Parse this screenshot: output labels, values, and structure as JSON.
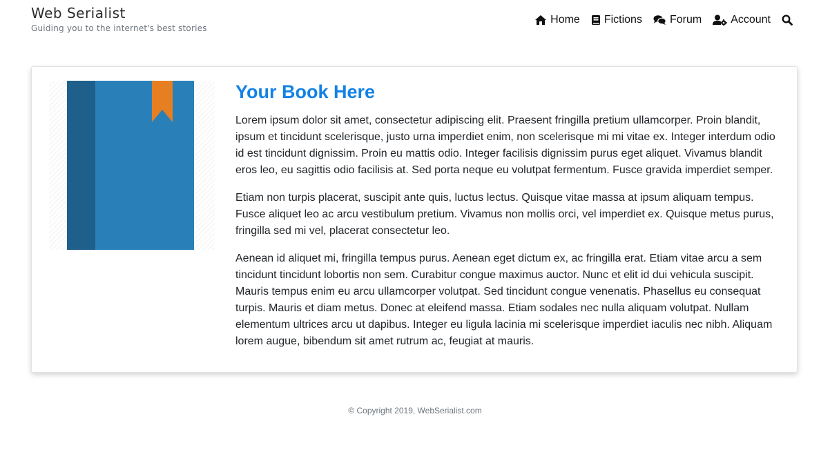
{
  "site": {
    "title": "Web Serialist",
    "tagline": "Guiding you to the internet's best stories"
  },
  "nav": {
    "items": [
      {
        "label": "Home",
        "icon": "home-icon"
      },
      {
        "label": "Fictions",
        "icon": "book-icon"
      },
      {
        "label": "Forum",
        "icon": "comments-icon"
      },
      {
        "label": "Account",
        "icon": "user-cog-icon"
      }
    ],
    "search_icon": "search-icon"
  },
  "book": {
    "title": "Your Book Here",
    "cover_colors": {
      "spine": "#1f5f8b",
      "cover": "#2980b9",
      "bookmark": "#e67e22"
    },
    "paragraphs": [
      "Lorem ipsum dolor sit amet, consectetur adipiscing elit. Praesent fringilla pretium ullamcorper. Proin blandit, ipsum et tincidunt scelerisque, justo urna imperdiet enim, non scelerisque mi mi vitae ex. Integer interdum odio id est tincidunt dignissim. Proin eu mattis odio. Integer facilisis dignissim purus eget aliquet. Vivamus blandit eros leo, eu sagittis odio facilisis at. Sed porta neque eu volutpat fermentum. Fusce gravida imperdiet semper.",
      "Etiam non turpis placerat, suscipit ante quis, luctus lectus. Quisque vitae massa at ipsum aliquam tempus. Fusce aliquet leo ac arcu vestibulum pretium. Vivamus non mollis orci, vel imperdiet ex. Quisque metus purus, fringilla sed mi vel, placerat consectetur leo.",
      "Aenean id aliquet mi, fringilla tempus purus. Aenean eget dictum ex, ac fringilla erat. Etiam vitae arcu a sem tincidunt tincidunt lobortis non sem. Curabitur congue maximus auctor. Nunc et elit id dui vehicula suscipit. Mauris tempus enim eu arcu ullamcorper volutpat. Sed tincidunt congue venenatis. Phasellus eu consequat turpis. Mauris et diam metus. Donec at eleifend massa. Etiam sodales nec nulla aliquam volutpat. Nullam elementum ultrices arcu ut dapibus. Integer eu ligula lacinia mi scelerisque imperdiet iaculis nec nibh. Aliquam lorem augue, bibendum sit amet rutrum ac, feugiat at mauris."
    ]
  },
  "footer": {
    "copyright": "© Copyright 2019, WebSerialist.com"
  },
  "colors": {
    "accent": "#1282e6"
  }
}
